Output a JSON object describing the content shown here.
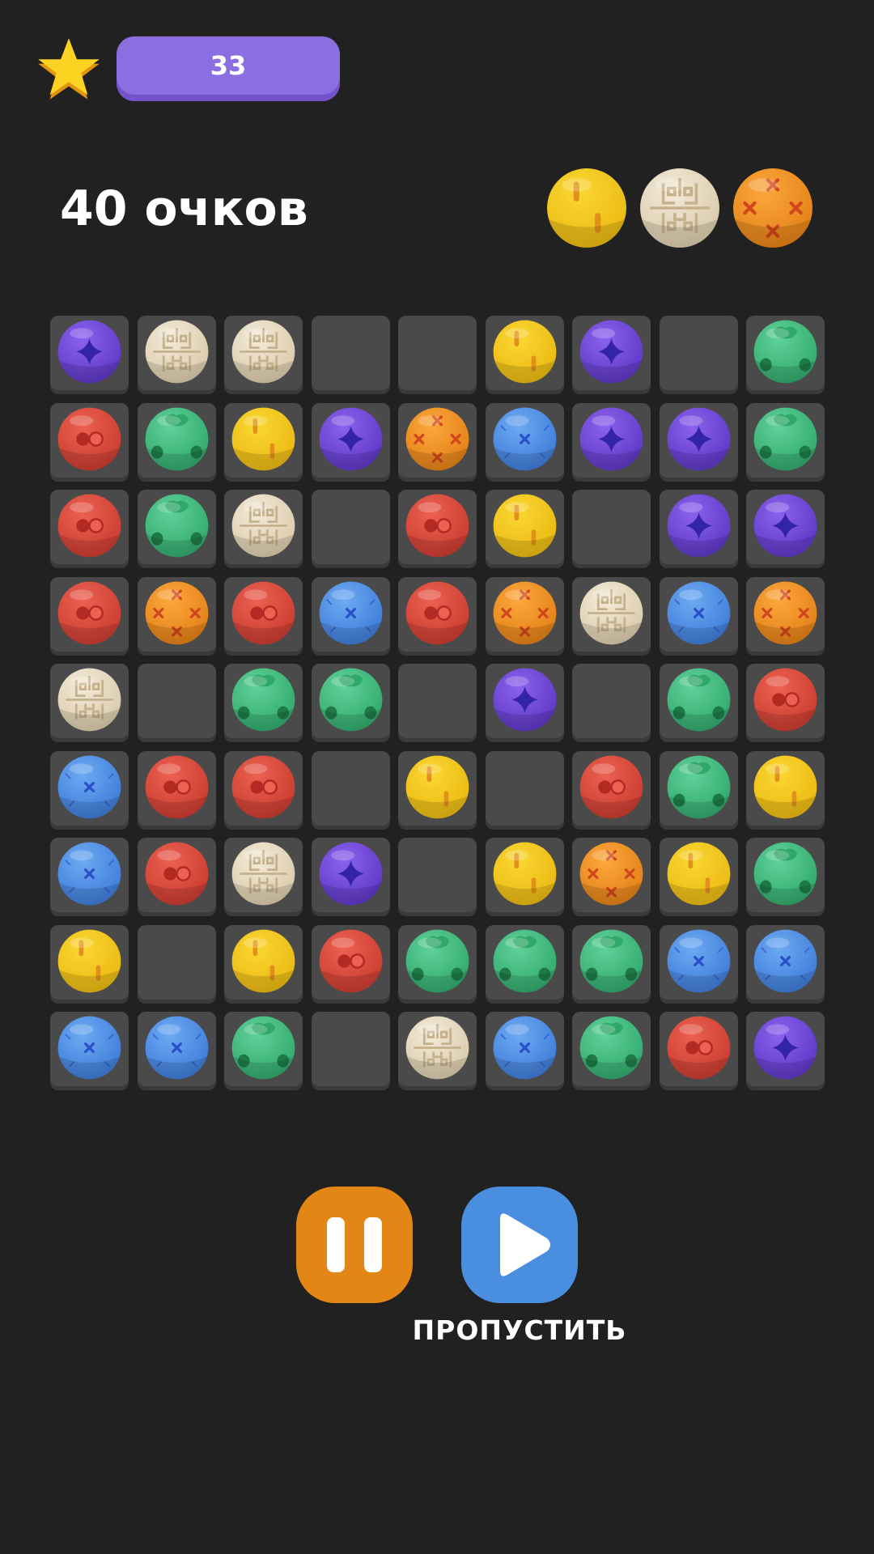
{
  "header": {
    "star_icon": "star-icon",
    "score_value": "33"
  },
  "points": {
    "label": "40 очков"
  },
  "next_balls": [
    "yellow",
    "cream",
    "orange"
  ],
  "board": {
    "rows": 9,
    "cols": 9,
    "grid": [
      [
        "purple",
        "cream",
        "cream",
        null,
        null,
        "yellow",
        "purple",
        null,
        "green"
      ],
      [
        "red",
        "green",
        "yellow",
        "purple",
        "orange",
        "blue",
        "purple",
        "purple",
        "green"
      ],
      [
        "red",
        "green",
        "cream",
        null,
        "red",
        "yellow",
        null,
        "purple",
        "purple"
      ],
      [
        "red",
        "orange",
        "red",
        "blue",
        "red",
        "orange",
        "cream",
        "blue",
        "orange"
      ],
      [
        "cream",
        null,
        "green",
        "green",
        null,
        "purple",
        null,
        "green",
        "red"
      ],
      [
        "blue",
        "red",
        "red",
        null,
        "yellow",
        null,
        "red",
        "green",
        "yellow"
      ],
      [
        "blue",
        "red",
        "cream",
        "purple",
        null,
        "yellow",
        "orange",
        "yellow",
        "green"
      ],
      [
        "yellow",
        null,
        "yellow",
        "red",
        "green",
        "green",
        "green",
        "blue",
        "blue"
      ],
      [
        "blue",
        "blue",
        "green",
        null,
        "cream",
        "blue",
        "green",
        "red",
        "purple"
      ]
    ]
  },
  "controls": {
    "pause_icon": "pause-icon",
    "skip_icon": "play-icon",
    "skip_label": "ПРОПУСТИТЬ"
  },
  "colors": {
    "background": "#212121",
    "cell": "#4a4a4a",
    "score_pill": "#8b6fe0",
    "pause_button": "#e38615",
    "skip_button": "#4a8ee0"
  }
}
